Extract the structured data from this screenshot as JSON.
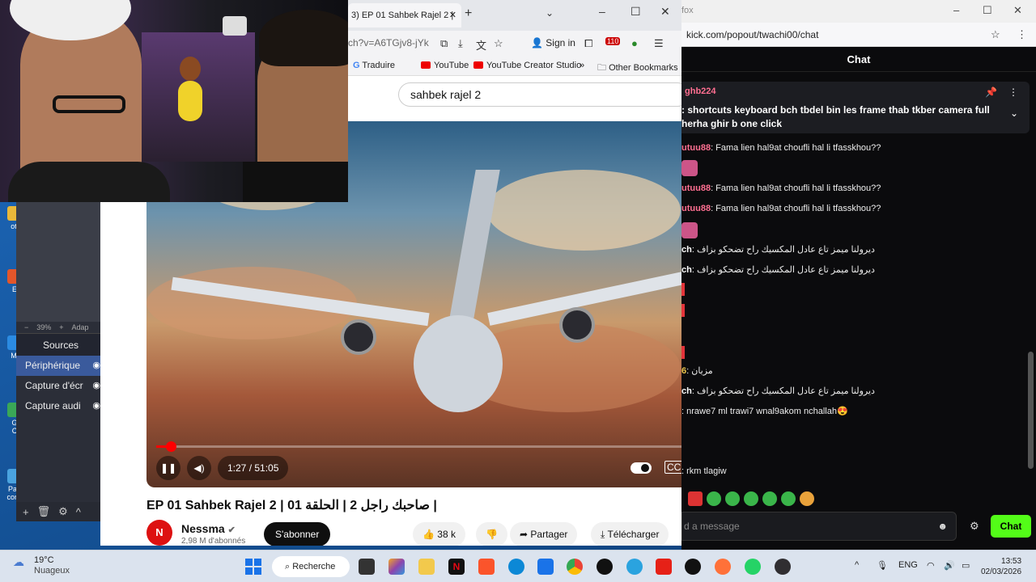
{
  "desktop": {
    "icons": [
      "oti",
      "E",
      "Mi",
      "G",
      "C",
      "Pan",
      "confi"
    ]
  },
  "obs": {
    "zoom_minus": "−",
    "zoom": "39%",
    "zoom_plus": "+",
    "zoom_adapt": "Adap",
    "sources_header": "Sources",
    "sources": [
      "Périphérique",
      "Capture d'écr",
      "Capture audi"
    ],
    "tools": [
      "+",
      "🗑",
      "⚙",
      "^",
      "v"
    ]
  },
  "browser": {
    "tab_title": "3) EP 01 Sahbek Rajel 2 | ",
    "url_partial": "ch?v=A6TGjv8-jYk",
    "sign_in": "Sign in",
    "badge": "110",
    "bookmarks": [
      "Traduire",
      "YouTube",
      "YouTube Creator Studio",
      "Other Bookmarks"
    ],
    "search_query": "sahbek rajel 2",
    "video_time": "1:27 / 51:05",
    "video_progress": 0.028,
    "video_title": "EP 01 Sahbek Rajel 2 | صاحبك راجل 2 | الحلقة 01 |",
    "channel_name": "Nessma",
    "channel_subs": "2,98 M d'abonnés",
    "subscribe": "S'abonner",
    "likes": "38 k",
    "share": "Partager",
    "download": "Télécharger"
  },
  "chat": {
    "window_title": "fox",
    "url": "kick.com/popout/twachi00/chat",
    "header": "Chat",
    "pinned_user": "ghb224",
    "pinned_message": ": shortcuts keyboard bch tbdel bin les frame thab tkber camera full\nherha ghir b one click",
    "messages": [
      {
        "user": "utuu88",
        "text": ": Fama lien hal9at choufli hal li tfasskhou??",
        "color": "#ff6f91"
      },
      {
        "user": "",
        "text": "",
        "color": "#ff6f91"
      },
      {
        "user": "utuu88",
        "text": ": Fama lien hal9at choufli hal li tfasskhou??",
        "color": "#ff6f91"
      },
      {
        "user": "utuu88",
        "text": ": Fama lien hal9at choufli hal li tfasskhou??",
        "color": "#ff6f91"
      },
      {
        "user": "",
        "text": "",
        "color": "#ff6f91"
      },
      {
        "user": "ch",
        "text": ": ديرولنا ميمز تاع عادل المكسيك راح تضحكو بزاف",
        "color": "#ffffff"
      },
      {
        "user": "ch",
        "text": ": ديرولنا ميمز تاع عادل المكسيك راح تضحكو بزاف",
        "color": "#ffffff"
      },
      {
        "user": "6",
        "text": ": مزيان",
        "color": "#f2c94c"
      },
      {
        "user": "ch",
        "text": ": ديرولنا ميمز تاع عادل المكسيك راح تضحكو بزاف",
        "color": "#ffffff"
      },
      {
        "user": "",
        "text": ": nrawe7 ml trawi7 wnal9akom nchallah😍",
        "color": "#ffffff"
      },
      {
        "user": "",
        "text": ": rkm tlagiw",
        "color": "#ffffff"
      }
    ],
    "input_placeholder": "d a message",
    "send": "Chat"
  },
  "taskbar": {
    "temperature": "19°C",
    "weather": "Nuageux",
    "search": "Recherche",
    "lang": "ENG",
    "time": "13:53",
    "date": "02/03/2026"
  }
}
